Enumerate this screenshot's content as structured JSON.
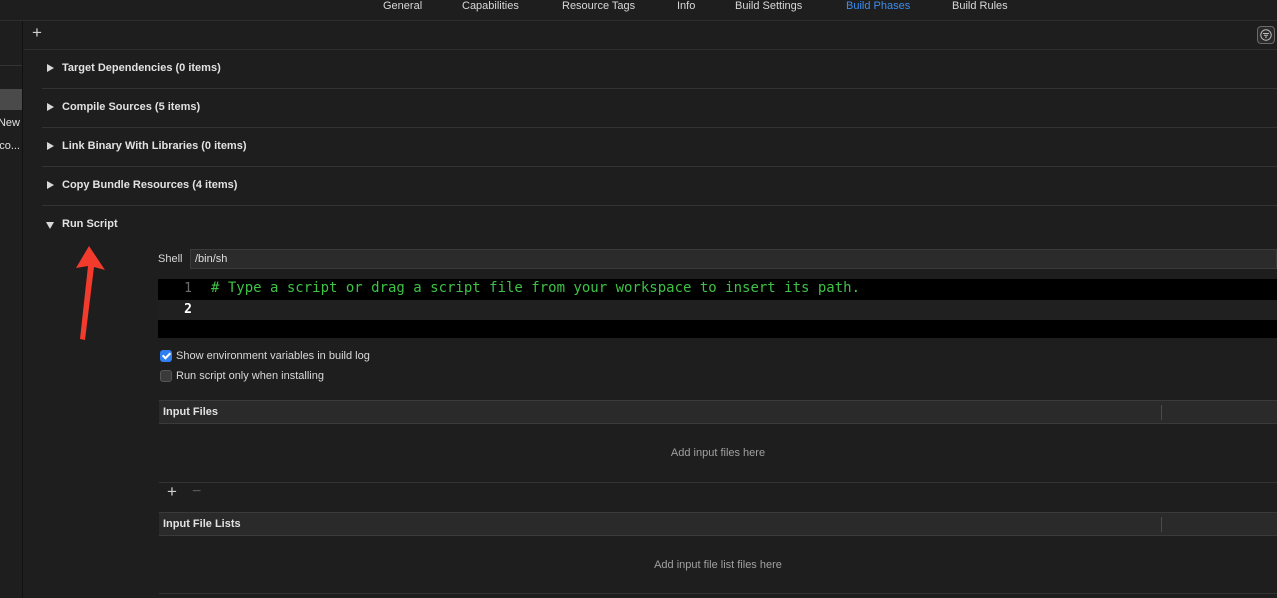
{
  "tabs": [
    {
      "label": "General",
      "active": false
    },
    {
      "label": "Capabilities",
      "active": false
    },
    {
      "label": "Resource Tags",
      "active": false
    },
    {
      "label": "Info",
      "active": false
    },
    {
      "label": "Build Settings",
      "active": false
    },
    {
      "label": "Build Phases",
      "active": true
    },
    {
      "label": "Build Rules",
      "active": false
    }
  ],
  "sidebar": {
    "item1": "New",
    "item2": "co..."
  },
  "toolbar": {
    "add_icon": "plus-icon",
    "filter_icon": "filter-icon"
  },
  "phases": [
    {
      "title": "Target Dependencies (0 items)",
      "expanded": false
    },
    {
      "title": "Compile Sources (5 items)",
      "expanded": false
    },
    {
      "title": "Link Binary With Libraries (0 items)",
      "expanded": false
    },
    {
      "title": "Copy Bundle Resources (4 items)",
      "expanded": false
    },
    {
      "title": "Run Script",
      "expanded": true
    }
  ],
  "run_script": {
    "shell_label": "Shell",
    "shell_value": "/bin/sh",
    "lines": [
      {
        "number": "1",
        "code": "# Type a script or drag a script file from your workspace to insert its path."
      },
      {
        "number": "2",
        "code": ""
      }
    ],
    "show_env_label": "Show environment variables in build log",
    "show_env_checked": true,
    "only_installing_label": "Run script only when installing",
    "only_installing_checked": false,
    "input_files": {
      "header": "Input Files",
      "empty": "Add input files here",
      "add": "+",
      "remove": "−"
    },
    "input_file_lists": {
      "header": "Input File Lists",
      "empty": "Add input file list files here"
    }
  },
  "colors": {
    "accent": "#3c8df0",
    "code_comment": "#3ec145",
    "annotation_arrow": "#f23b2c"
  }
}
